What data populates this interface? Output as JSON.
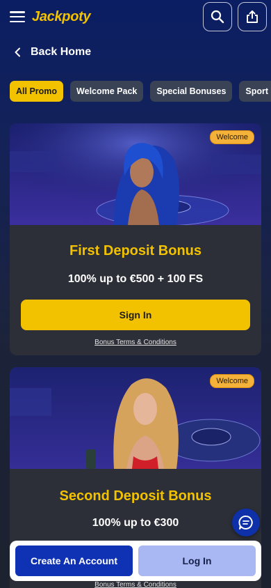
{
  "header": {
    "logo_text": "Jackpoty",
    "menu_icon": "hamburger-menu-icon",
    "search_icon": "search-icon",
    "share_icon": "share-upload-icon"
  },
  "nav": {
    "back_label": "Back Home"
  },
  "tabs": [
    {
      "label": "All Promo",
      "active": true
    },
    {
      "label": "Welcome Pack",
      "active": false
    },
    {
      "label": "Special Bonuses",
      "active": false
    },
    {
      "label": "Sport Bonuses",
      "active": false
    }
  ],
  "promos": [
    {
      "badge": "Welcome",
      "title": "First Deposit Bonus",
      "offer": "100% up to €500 + 100 FS",
      "button_label": "Sign In",
      "terms_label": "Bonus Terms & Conditions"
    },
    {
      "badge": "Welcome",
      "title": "Second Deposit Bonus",
      "offer": "100% up to €300",
      "terms_label": "Bonus Terms & Conditions"
    }
  ],
  "bottom_bar": {
    "create_label": "Create An Account",
    "login_label": "Log In"
  },
  "colors": {
    "accent": "#f2c200",
    "primary": "#0f32b4",
    "secondary": "#a9b7f2",
    "badge": "#f5b23a",
    "card": "#2c2f38"
  }
}
